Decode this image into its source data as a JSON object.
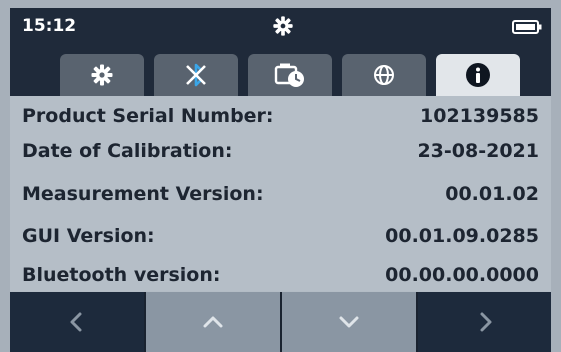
{
  "status": {
    "time": "15:12",
    "center_icon": "gear-icon",
    "right_icon": "battery-icon"
  },
  "tabs": [
    {
      "icon": "settings-gear-icon",
      "active": false
    },
    {
      "icon": "bluetooth-off-icon",
      "active": false
    },
    {
      "icon": "timer-icon",
      "active": false
    },
    {
      "icon": "globe-icon",
      "active": false
    },
    {
      "icon": "info-icon",
      "active": true
    }
  ],
  "info": {
    "rows": [
      {
        "label": "Product Serial Number:",
        "value": "102139585"
      },
      {
        "label": "Date of Calibration:",
        "value": "23-08-2021"
      },
      {
        "label": "Measurement Version:",
        "value": "00.01.02"
      },
      {
        "label": "GUI Version:",
        "value": "00.01.09.0285"
      },
      {
        "label": "Bluetooth version:",
        "value": "00.00.00.0000"
      }
    ]
  },
  "nav": [
    {
      "icon": "chevron-left-icon"
    },
    {
      "icon": "chevron-up-icon"
    },
    {
      "icon": "chevron-down-icon"
    },
    {
      "icon": "chevron-right-icon"
    }
  ],
  "colors": {
    "topbar": "#1f2a3a",
    "tab_inactive": "#59636f",
    "tab_active": "#e2e6ea",
    "content_bg": "#b5bec7",
    "text": "#1d2531",
    "nav_light": "#8a96a3",
    "nav_dark": "#1d2a3c"
  }
}
